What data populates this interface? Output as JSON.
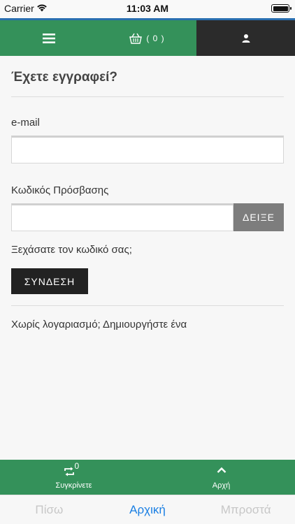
{
  "status_bar": {
    "carrier": "Carrier",
    "time": "11:03 AM"
  },
  "top_nav": {
    "cart_count": "( 0 )",
    "accent_color": "#34915a",
    "dark_color": "#2b2b2b"
  },
  "login": {
    "heading": "Έχετε εγγραφεί?",
    "email_label": "e-mail",
    "email_value": "",
    "password_label": "Κωδικός Πρόσβασης",
    "password_value": "",
    "show_button": "ΔΕΙΞΕ",
    "forgot_link": "Ξεχάσατε τον κωδικό σας;",
    "login_button": "ΣΥΝΔΕΣΗ",
    "no_account": "Χωρίς λογαριασμό; Δημιουργήστε ένα"
  },
  "bottom_bar": {
    "compare_count": "0",
    "compare_label": "Συγκρίνετε",
    "top_label": "Αρχή"
  },
  "tab_bar": {
    "back": "Πίσω",
    "home": "Αρχική",
    "forward": "Μπροστά"
  }
}
